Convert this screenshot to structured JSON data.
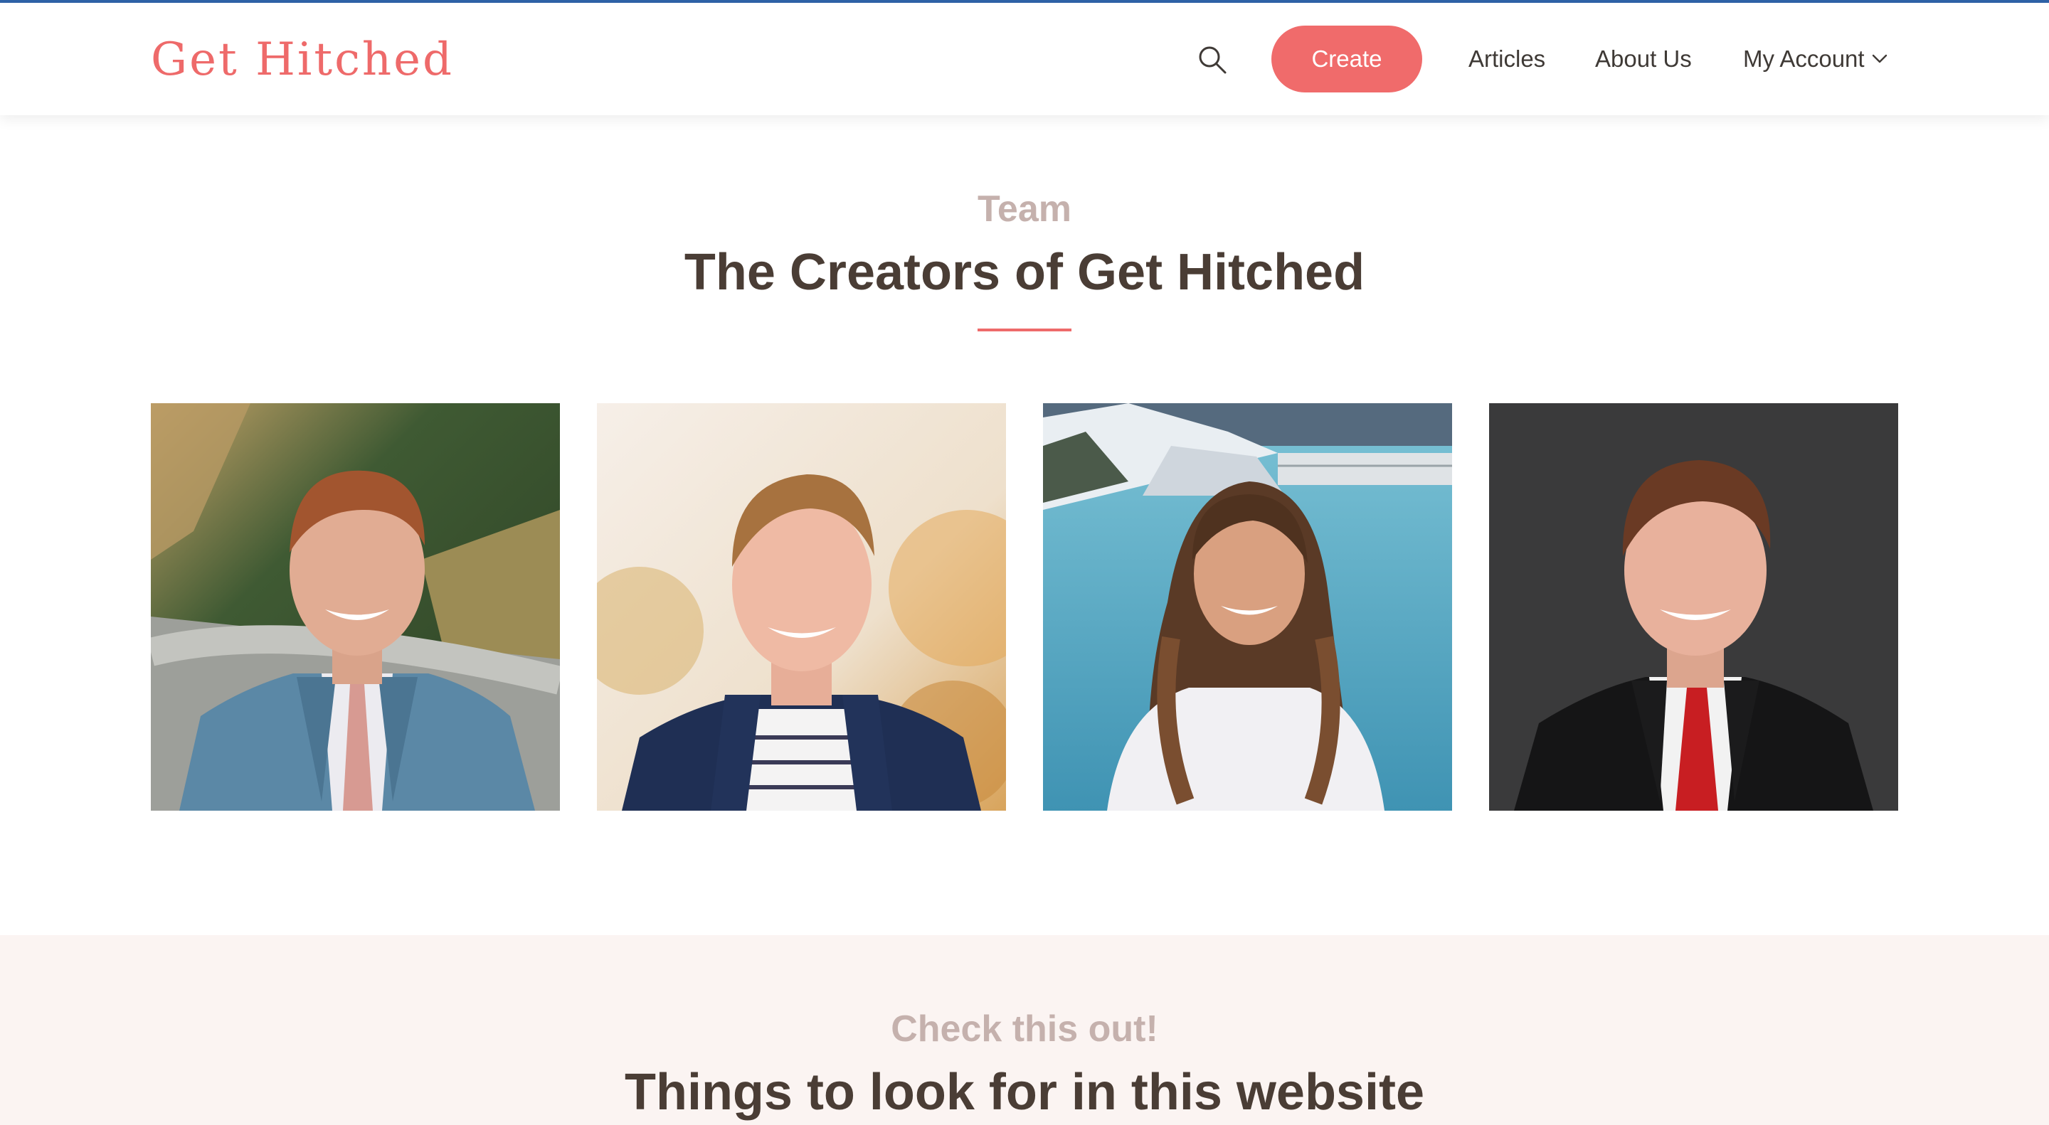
{
  "header": {
    "logo": "Get Hitched",
    "create_label": "Create",
    "nav": {
      "articles": "Articles",
      "about": "About Us",
      "account": "My Account"
    },
    "icons": {
      "search": "search-icon",
      "account_dropdown": "chevron-down-icon"
    }
  },
  "team": {
    "eyebrow": "Team",
    "heading": "The Creators of Get Hitched",
    "members": [
      {
        "photo": "team-member-photo"
      },
      {
        "photo": "team-member-photo"
      },
      {
        "photo": "team-member-photo"
      },
      {
        "photo": "team-member-photo"
      }
    ]
  },
  "features": {
    "eyebrow": "Check this out!",
    "heading": "Things to look for in this website"
  },
  "colors": {
    "brand": "#ee6a6a",
    "heading": "#4a3d35",
    "eyebrow": "#c5b1ad",
    "top_accent": "#2f63a8",
    "section_bg": "#fbf4f2"
  }
}
